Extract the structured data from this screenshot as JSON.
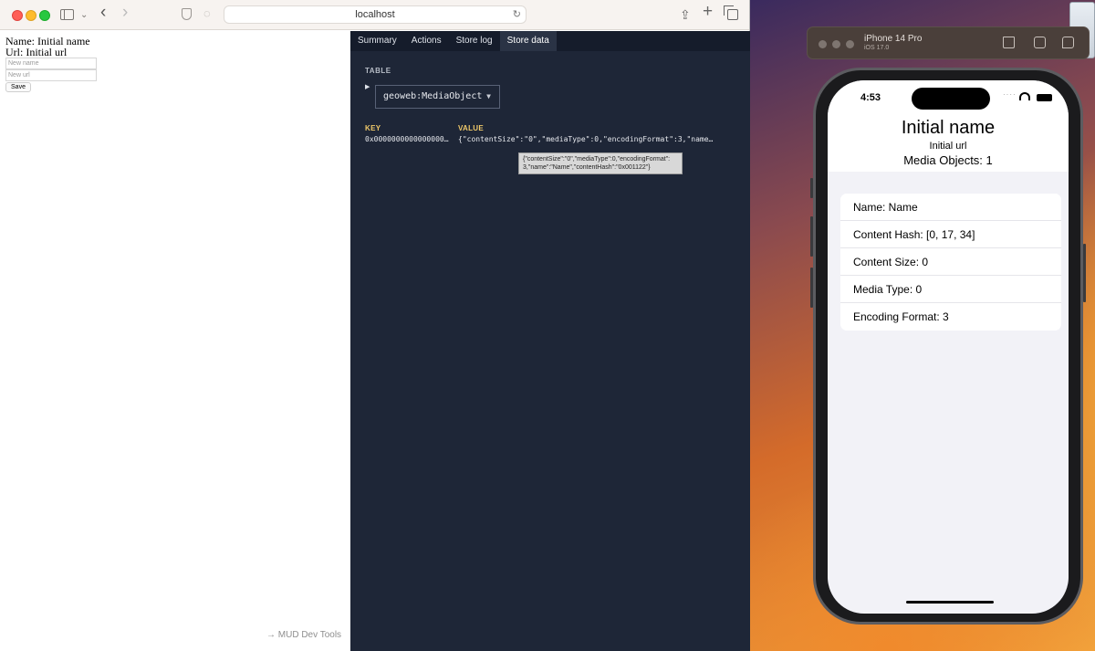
{
  "browser": {
    "url": "localhost"
  },
  "webpage": {
    "name_line": "Name: Initial name",
    "url_line": "Url: Initial url",
    "name_placeholder": "New name",
    "url_placeholder": "New url",
    "save_label": "Save",
    "devtools_link": "→ MUD Dev Tools"
  },
  "devtools": {
    "tabs": [
      "Summary",
      "Actions",
      "Store log",
      "Store data"
    ],
    "active_tab": "Store data",
    "table_label": "TABLE",
    "selected_table": "geoweb:MediaObject",
    "columns": {
      "key": "KEY",
      "value": "VALUE"
    },
    "rows": [
      {
        "key": "0x0000000000000000…",
        "value": "{\"contentSize\":\"0\",\"mediaType\":0,\"encodingFormat\":3,\"name…"
      }
    ],
    "tooltip": "{\"contentSize\":\"0\",\"mediaType\":0,\"encodingFormat\":3,\"name\":\"Name\",\"contentHash\":\"0x001122\"}"
  },
  "simulator": {
    "device_name": "iPhone 14 Pro",
    "os_version": "iOS 17.0",
    "status_time": "4:53",
    "app": {
      "title": "Initial name",
      "url": "Initial url",
      "count": "Media Objects: 1",
      "details": [
        "Name: Name",
        "Content Hash: [0, 17, 34]",
        "Content Size: 0",
        "Media Type: 0",
        "Encoding Format: 3"
      ]
    }
  }
}
